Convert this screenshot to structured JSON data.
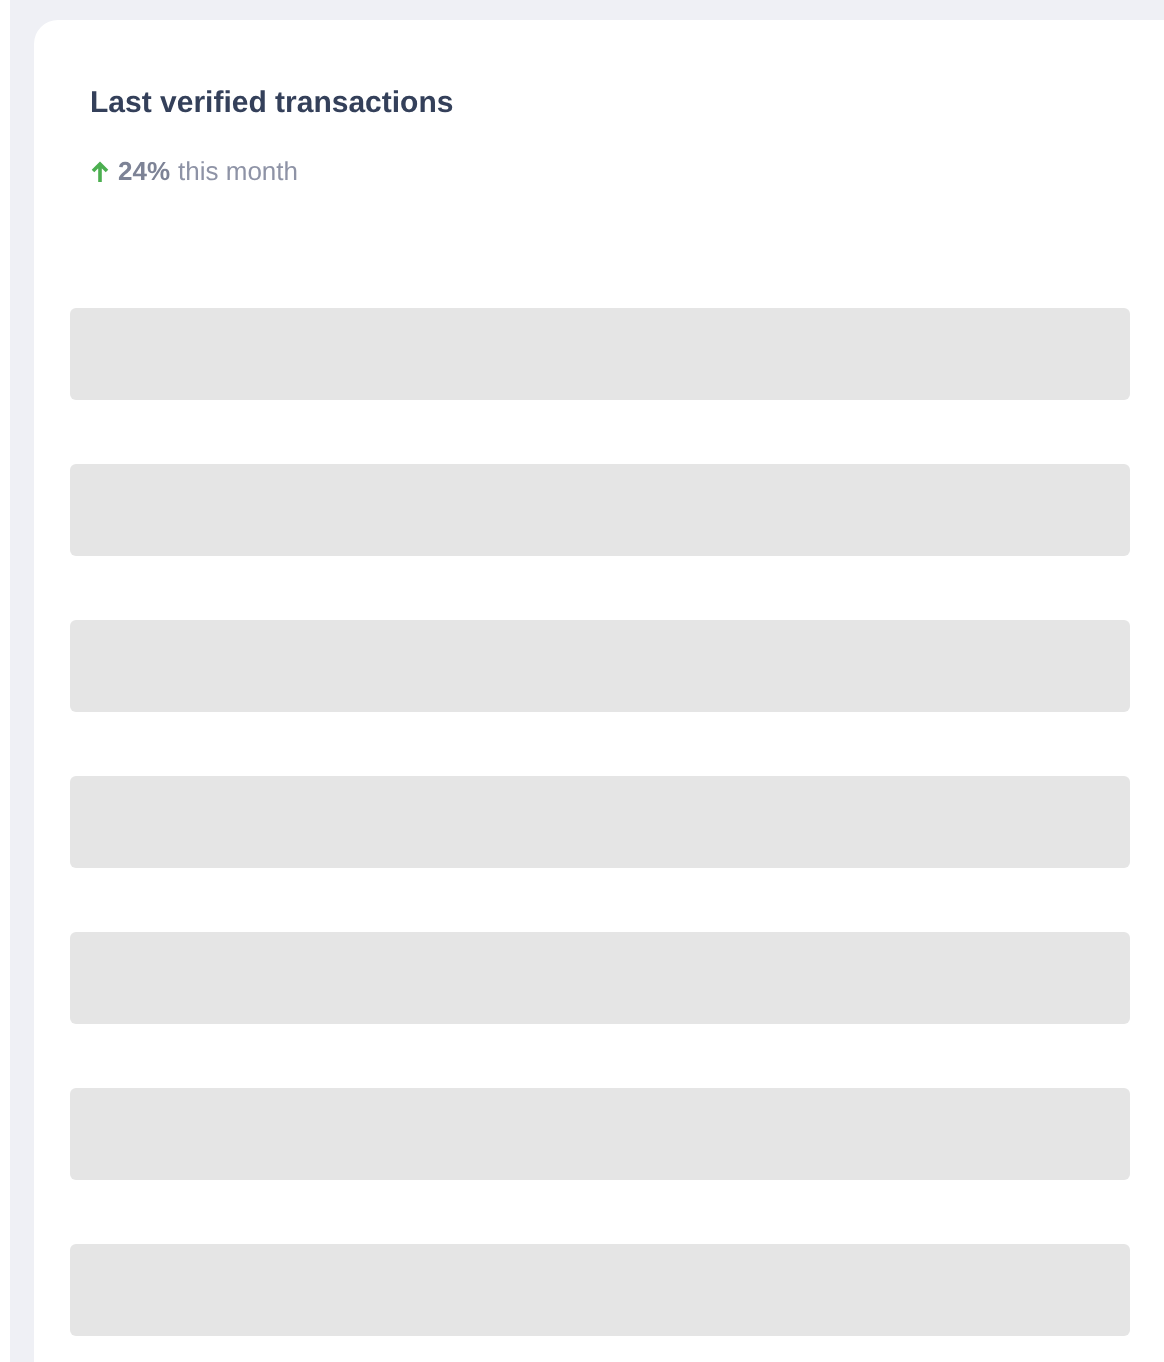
{
  "card": {
    "title": "Last verified transactions",
    "trend": {
      "rising": true,
      "value": "24%",
      "label": "this month"
    },
    "rows": [
      {
        "kind": "placeholder"
      },
      {
        "kind": "placeholder"
      },
      {
        "kind": "placeholder"
      },
      {
        "kind": "placeholder"
      },
      {
        "kind": "placeholder"
      },
      {
        "kind": "placeholder"
      },
      {
        "kind": "placeholder"
      }
    ]
  }
}
